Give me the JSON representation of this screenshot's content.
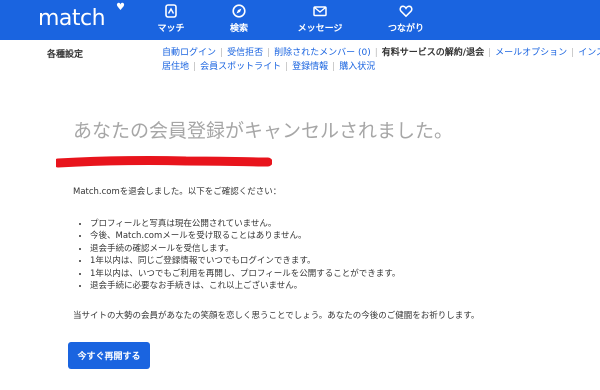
{
  "brand": {
    "logo_text": "match"
  },
  "nav": [
    {
      "label": "マッチ",
      "icon": "match-icon"
    },
    {
      "label": "検索",
      "icon": "compass-icon"
    },
    {
      "label": "メッセージ",
      "icon": "envelope-icon"
    },
    {
      "label": "つながり",
      "icon": "heart-icon"
    }
  ],
  "settings": {
    "label": "各種設定",
    "links_row1": [
      {
        "label": "自動ログイン"
      },
      {
        "label": "受信拒否"
      },
      {
        "label": "削除されたメンバー (0)"
      },
      {
        "label": "有料サービスの解約/退会"
      },
      {
        "label": "メールオプション"
      },
      {
        "label": "インス"
      }
    ],
    "links_row2": [
      {
        "label": "居住地"
      },
      {
        "label": "会員スポットライト"
      },
      {
        "label": "登録情報"
      },
      {
        "label": "購入状況"
      }
    ]
  },
  "main": {
    "headline": "あなたの会員登録がキャンセルされました。",
    "intro": "Match.comを退会しました。以下をご確認ください：",
    "bullets": [
      "プロフィールと写真は現在公開されていません。",
      "今後、Match.comメールを受け取ることはありません。",
      "退会手続の確認メールを受信します。",
      "1年以内は、同じご登録情報でいつでもログインできます。",
      "1年以内は、いつでもご利用を再開し、プロフィールを公開することができます。",
      "退会手続に必要なお手続きは、これ以上ございません。"
    ],
    "closing": "当サイトの大勢の会員があなたの笑顔を恋しく思うことでしょう。あなたの今後のご健闘をお祈りします。",
    "button_label": "今すぐ再開する"
  },
  "colors": {
    "brand_blue": "#1a64e0",
    "redaction_red": "#e8141c",
    "headline_gray": "#a6a6a6"
  }
}
